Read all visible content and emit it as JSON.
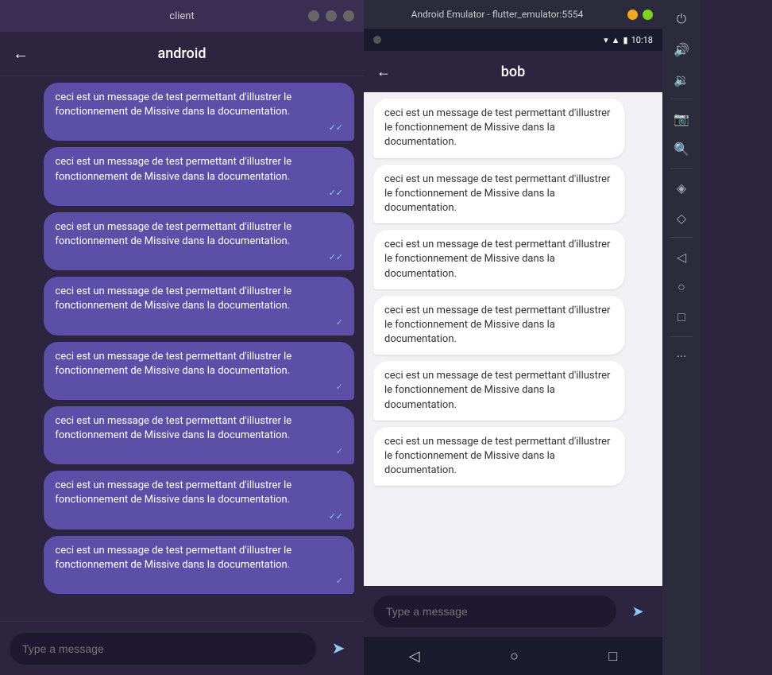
{
  "left": {
    "titlebar": "client",
    "header_title": "android",
    "back_label": "←",
    "messages": [
      {
        "text": "ceci est un message de test permettant d'illustrer le fonctionnement de Missive dans la documentation.",
        "tick": "✓✓",
        "tick_type": "double"
      },
      {
        "text": "ceci est un message de test permettant d'illustrer le fonctionnement de Missive dans la documentation.",
        "tick": "✓✓",
        "tick_type": "double"
      },
      {
        "text": "ceci est un message de test permettant d'illustrer le fonctionnement de Missive dans la documentation.",
        "tick": "✓✓",
        "tick_type": "double"
      },
      {
        "text": "ceci est un message de test permettant d'illustrer le fonctionnement de Missive dans la documentation.",
        "tick": "✓",
        "tick_type": "single"
      },
      {
        "text": "ceci est un message de test permettant d'illustrer le fonctionnement de Missive dans la documentation.",
        "tick": "✓",
        "tick_type": "single"
      },
      {
        "text": "ceci est un message de test permettant d'illustrer le fonctionnement de Missive dans la documentation.",
        "tick": "✓",
        "tick_type": "single"
      },
      {
        "text": "ceci est un message de test permettant d'illustrer le fonctionnement de Missive dans la documentation.",
        "tick": "✓✓",
        "tick_type": "double"
      },
      {
        "text": "ceci est un message de test permettant d'illustrer le fonctionnement de Missive dans la documentation.",
        "tick": "✓",
        "tick_type": "single"
      }
    ],
    "input_placeholder": "Type a message",
    "send_label": "➤"
  },
  "right": {
    "emulator_title": "Android Emulator - flutter_emulator:5554",
    "status_time": "10:18",
    "header_title": "bob",
    "back_label": "←",
    "messages": [
      {
        "text": "ceci est un message de test permettant d'illustrer le fonctionnement de Missive dans la documentation."
      },
      {
        "text": "ceci est un message de test permettant d'illustrer le fonctionnement de Missive dans la documentation."
      },
      {
        "text": "ceci est un message de test permettant d'illustrer le fonctionnement de Missive dans la documentation."
      },
      {
        "text": "ceci est un message de test permettant d'illustrer le fonctionnement de Missive dans la documentation."
      },
      {
        "text": "ceci est un message de test permettant d'illustrer le fonctionnement de Missive dans la documentation."
      },
      {
        "text": "ceci est un message de test permettant d'illustrer le fonctionnement de Missive dans la documentation."
      }
    ],
    "input_placeholder": "Type a message",
    "send_label": "➤",
    "nav": {
      "back": "◁",
      "home": "○",
      "recents": "□"
    },
    "sidebar_tools": [
      {
        "icon": "⏻",
        "name": "power"
      },
      {
        "icon": "🔊",
        "name": "volume-up"
      },
      {
        "icon": "🔉",
        "name": "volume-down"
      },
      {
        "icon": "📷",
        "name": "screenshot"
      },
      {
        "icon": "🔍",
        "name": "zoom"
      },
      {
        "icon": "◈",
        "name": "tag"
      },
      {
        "icon": "◇",
        "name": "erase"
      },
      {
        "icon": "◁",
        "name": "rotate"
      },
      {
        "icon": "○",
        "name": "circle"
      },
      {
        "icon": "□",
        "name": "square"
      },
      {
        "icon": "···",
        "name": "more"
      }
    ]
  }
}
